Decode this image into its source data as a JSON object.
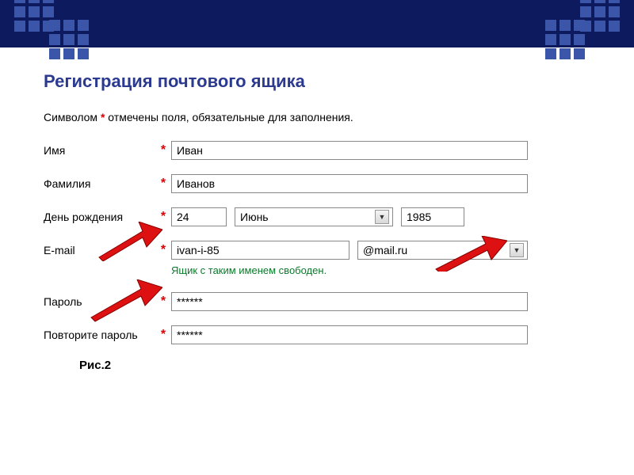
{
  "title": "Регистрация почтового ящика",
  "note_pre": "Символом",
  "note_ast": "*",
  "note_post": "отмечены поля, обязательные для заполнения.",
  "fields": {
    "name_label": "Имя",
    "name_value": "Иван",
    "surname_label": "Фамилия",
    "surname_value": "Иванов",
    "birthday_label": "День рождения",
    "birthday_day": "24",
    "birthday_month": "Июнь",
    "birthday_year": "1985",
    "email_label": "E-mail",
    "email_user": "ivan-i-85",
    "email_domain": "@mail.ru",
    "email_hint": "Ящик с таким именем свободен.",
    "password_label": "Пароль",
    "password_value": "******",
    "password2_label": "Повторите пароль",
    "password2_value": "******"
  },
  "caption": "Рис.2"
}
